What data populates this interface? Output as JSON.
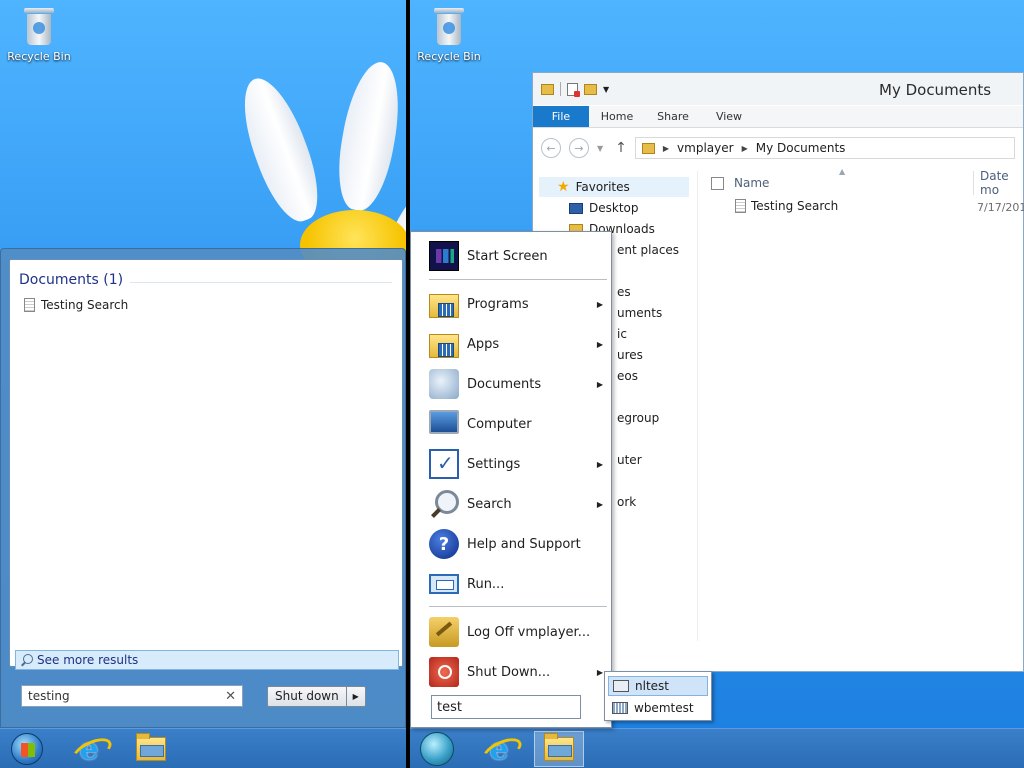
{
  "left_desktop": {
    "recycle_bin_label": "Recycle Bin",
    "search_panel": {
      "category": "Documents (1)",
      "results": [
        "Testing Search"
      ],
      "see_more": "See more results",
      "search_value": "testing",
      "shutdown_label": "Shut down"
    },
    "taskbar": [
      "start-orb",
      "internet-explorer",
      "file-explorer"
    ]
  },
  "right_desktop": {
    "recycle_bin_label": "Recycle Bin",
    "explorer": {
      "title": "My Documents",
      "ribbon_tabs": [
        "File",
        "Home",
        "Share",
        "View"
      ],
      "address": [
        "vmplayer",
        "My Documents"
      ],
      "nav_favorites": "Favorites",
      "nav_items": [
        "Desktop",
        "Downloads",
        "ent places",
        "es",
        "uments",
        "ic",
        "ures",
        "eos",
        "egroup",
        "uter",
        "ork"
      ],
      "columns": {
        "name": "Name",
        "date": "Date mo"
      },
      "files": [
        {
          "name": "Testing Search",
          "date": "7/17/201"
        }
      ]
    },
    "start_menu": {
      "items": [
        {
          "label": "Start Screen",
          "icon": "start-screen-icon",
          "submenu": false
        },
        {
          "label": "Programs",
          "icon": "programs-folder-icon",
          "submenu": true
        },
        {
          "label": "Apps",
          "icon": "apps-folder-icon",
          "submenu": true
        },
        {
          "label": "Documents",
          "icon": "documents-icon",
          "submenu": true
        },
        {
          "label": "Computer",
          "icon": "computer-icon",
          "submenu": false
        },
        {
          "label": "Settings",
          "icon": "settings-icon",
          "submenu": true
        },
        {
          "label": "Search",
          "icon": "search-icon",
          "submenu": true
        },
        {
          "label": "Help and Support",
          "icon": "help-icon",
          "submenu": false
        },
        {
          "label": "Run...",
          "icon": "run-icon",
          "submenu": false
        },
        {
          "label": "Log Off vmplayer...",
          "icon": "log-off-icon",
          "submenu": false
        },
        {
          "label": "Shut Down...",
          "icon": "power-icon",
          "submenu": true
        }
      ],
      "search_value": "test",
      "results": [
        "nltest",
        "wbemtest"
      ]
    },
    "taskbar": [
      "classic-shell-orb",
      "internet-explorer",
      "file-explorer"
    ]
  }
}
